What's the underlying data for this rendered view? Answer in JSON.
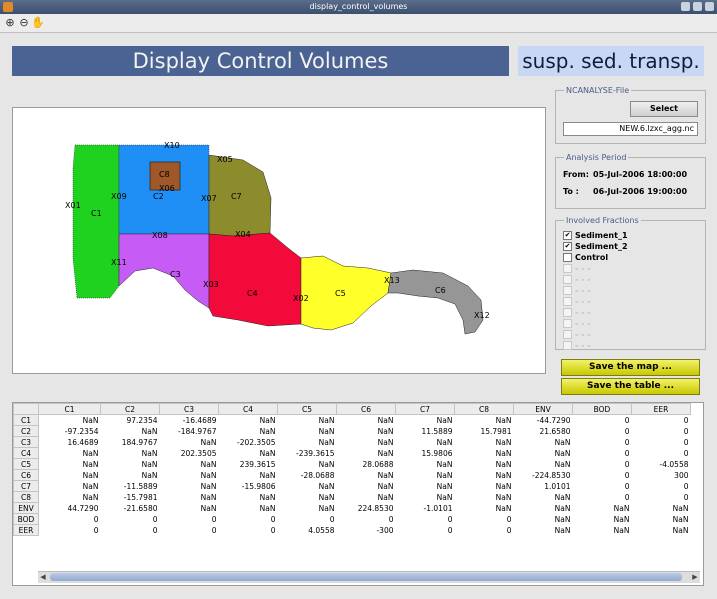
{
  "window": {
    "title": "display_control_volumes"
  },
  "toolbar": {
    "icons": [
      "zoom-in-icon",
      "zoom-out-icon",
      "pan-hand-icon"
    ]
  },
  "header": {
    "title": "Display Control Volumes",
    "label": "susp. sed. transp.",
    "title_color": "#4a6392",
    "label_color": "#c8d8f4"
  },
  "map": {
    "cells": [
      {
        "name": "C1",
        "color": "#1fd21f"
      },
      {
        "name": "C2",
        "color": "#1f8ff5"
      },
      {
        "name": "C8",
        "color": "#a0582a"
      },
      {
        "name": "C7",
        "color": "#8c8c2c"
      },
      {
        "name": "C3",
        "color": "#c65cf5"
      },
      {
        "name": "C4",
        "color": "#f20a3a"
      },
      {
        "name": "C5",
        "color": "#ffff2a"
      },
      {
        "name": "C6",
        "color": "#969696"
      }
    ],
    "labels": [
      "C1",
      "C2",
      "C8",
      "C7",
      "C3",
      "C4",
      "C5",
      "C6",
      "X01",
      "X10",
      "X09",
      "X06",
      "X05",
      "X07",
      "X08",
      "X04",
      "X11",
      "X03",
      "X02",
      "X13",
      "X12"
    ]
  },
  "ncanalyse": {
    "title": "NCANALYSE-File",
    "select_label": "Select",
    "file": "NEW.6.lzxc_agg.nc"
  },
  "analysis": {
    "title": "Analysis Period",
    "from_label": "From:",
    "from_value": "05-Jul-2006 18:00:00",
    "to_label": "To :",
    "to_value": "06-Jul-2006 19:00:00"
  },
  "fractions": {
    "title": "Involved Fractions",
    "items": [
      {
        "label": "Sediment_1",
        "checked": "✔"
      },
      {
        "label": "Sediment_2",
        "checked": "✔"
      },
      {
        "label": "Control",
        "checked": ""
      },
      {
        "label": "- - -",
        "checked": ""
      },
      {
        "label": "- - -",
        "checked": ""
      },
      {
        "label": "- - -",
        "checked": ""
      },
      {
        "label": "- - -",
        "checked": ""
      },
      {
        "label": "- - -",
        "checked": ""
      },
      {
        "label": "- - -",
        "checked": ""
      },
      {
        "label": "- - -",
        "checked": ""
      },
      {
        "label": "- - -",
        "checked": ""
      }
    ]
  },
  "actions": {
    "save_map": "Save the map ...",
    "save_table": "Save the table ...",
    "button_color": "#e0e020"
  },
  "table": {
    "columns": [
      "C1",
      "C2",
      "C3",
      "C4",
      "C5",
      "C6",
      "C7",
      "C8",
      "ENV",
      "BOD",
      "EER"
    ],
    "rows": [
      {
        "h": "C1",
        "v": [
          "NaN",
          "97.2354",
          "-16.4689",
          "NaN",
          "NaN",
          "NaN",
          "NaN",
          "NaN",
          "-44.7290",
          "0",
          "0"
        ]
      },
      {
        "h": "C2",
        "v": [
          "-97.2354",
          "NaN",
          "-184.9767",
          "NaN",
          "NaN",
          "NaN",
          "11.5889",
          "15.7981",
          "21.6580",
          "0",
          "0"
        ]
      },
      {
        "h": "C3",
        "v": [
          "16.4689",
          "184.9767",
          "NaN",
          "-202.3505",
          "NaN",
          "NaN",
          "NaN",
          "NaN",
          "NaN",
          "0",
          "0"
        ]
      },
      {
        "h": "C4",
        "v": [
          "NaN",
          "NaN",
          "202.3505",
          "NaN",
          "-239.3615",
          "NaN",
          "15.9806",
          "NaN",
          "NaN",
          "0",
          "0"
        ]
      },
      {
        "h": "C5",
        "v": [
          "NaN",
          "NaN",
          "NaN",
          "239.3615",
          "NaN",
          "28.0688",
          "NaN",
          "NaN",
          "NaN",
          "0",
          "-4.0558"
        ]
      },
      {
        "h": "C6",
        "v": [
          "NaN",
          "NaN",
          "NaN",
          "NaN",
          "-28.0688",
          "NaN",
          "NaN",
          "NaN",
          "-224.8530",
          "0",
          "300"
        ]
      },
      {
        "h": "C7",
        "v": [
          "NaN",
          "-11.5889",
          "NaN",
          "-15.9806",
          "NaN",
          "NaN",
          "NaN",
          "NaN",
          "1.0101",
          "0",
          "0"
        ]
      },
      {
        "h": "C8",
        "v": [
          "NaN",
          "-15.7981",
          "NaN",
          "NaN",
          "NaN",
          "NaN",
          "NaN",
          "NaN",
          "NaN",
          "0",
          "0"
        ]
      },
      {
        "h": "ENV",
        "v": [
          "44.7290",
          "-21.6580",
          "NaN",
          "NaN",
          "NaN",
          "224.8530",
          "-1.0101",
          "NaN",
          "NaN",
          "NaN",
          "NaN"
        ]
      },
      {
        "h": "BOD",
        "v": [
          "0",
          "0",
          "0",
          "0",
          "0",
          "0",
          "0",
          "0",
          "NaN",
          "NaN",
          "NaN"
        ]
      },
      {
        "h": "EER",
        "v": [
          "0",
          "0",
          "0",
          "0",
          "4.0558",
          "-300",
          "0",
          "0",
          "NaN",
          "NaN",
          "NaN"
        ]
      }
    ]
  }
}
